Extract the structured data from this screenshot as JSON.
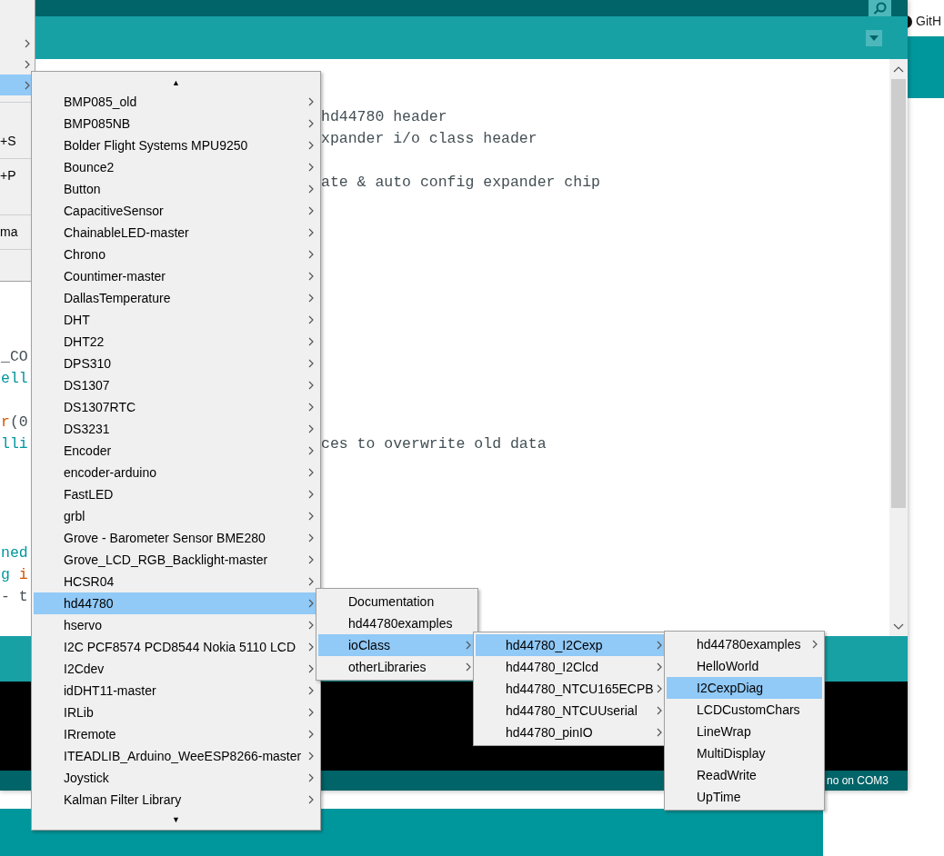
{
  "browser": {
    "link": "GitH"
  },
  "window": {
    "status": "no on COM3"
  },
  "file_menu": [
    {
      "kind": "submenu",
      "selected": false
    },
    {
      "kind": "submenu",
      "selected": false
    },
    {
      "kind": "submenu",
      "selected": true
    },
    {
      "kind": "separator"
    },
    {
      "kind": "blank"
    },
    {
      "kind": "shortcut",
      "text": "+S"
    },
    {
      "kind": "separator"
    },
    {
      "kind": "shortcut",
      "text": "+P"
    },
    {
      "kind": "blank"
    },
    {
      "kind": "separator"
    },
    {
      "kind": "shortcut",
      "text": "ma"
    },
    {
      "kind": "separator"
    }
  ],
  "editor": {
    "lines": [
      {
        "kind": "blank"
      },
      {
        "kind": "code",
        "right": "hd44780 header"
      },
      {
        "kind": "code",
        "right": "xpander i/o class header"
      },
      {
        "kind": "blank"
      },
      {
        "kind": "code",
        "right": "ate & auto config expander chip"
      },
      {
        "kind": "blank"
      },
      {
        "kind": "blank"
      },
      {
        "kind": "blank"
      },
      {
        "kind": "blank"
      },
      {
        "kind": "blank"
      },
      {
        "kind": "blank"
      },
      {
        "kind": "blank"
      },
      {
        "kind": "code",
        "left": [
          {
            "kind": "plain",
            "text": "_CO"
          }
        ]
      },
      {
        "kind": "code",
        "left": [
          {
            "kind": "literal",
            "text": "ell"
          }
        ]
      },
      {
        "kind": "blank"
      },
      {
        "kind": "code",
        "left": [
          {
            "kind": "keyword",
            "text": "r"
          },
          {
            "kind": "plain",
            "text": "(0"
          }
        ]
      },
      {
        "kind": "code",
        "left": [
          {
            "kind": "literal",
            "text": "lli"
          }
        ],
        "right": "ces to overwrite old data"
      },
      {
        "kind": "blank"
      },
      {
        "kind": "blank"
      },
      {
        "kind": "blank"
      },
      {
        "kind": "blank"
      },
      {
        "kind": "code",
        "left": [
          {
            "kind": "literal",
            "text": "ned"
          }
        ]
      },
      {
        "kind": "code",
        "left": [
          {
            "kind": "literal",
            "text": "g "
          },
          {
            "kind": "keyword",
            "text": "i"
          }
        ]
      },
      {
        "kind": "code",
        "left": [
          {
            "kind": "plain",
            "text": "- t"
          }
        ]
      }
    ]
  },
  "menus": [
    {
      "scroll_up": "▲",
      "scroll_down": "▼",
      "items": [
        {
          "label": "BMP085_old",
          "selected": false,
          "submenu": true
        },
        {
          "label": "BMP085NB",
          "selected": false,
          "submenu": true
        },
        {
          "label": "Bolder Flight Systems MPU9250",
          "selected": false,
          "submenu": true
        },
        {
          "label": "Bounce2",
          "selected": false,
          "submenu": true
        },
        {
          "label": "Button",
          "selected": false,
          "submenu": true
        },
        {
          "label": "CapacitiveSensor",
          "selected": false,
          "submenu": true
        },
        {
          "label": "ChainableLED-master",
          "selected": false,
          "submenu": true
        },
        {
          "label": "Chrono",
          "selected": false,
          "submenu": true
        },
        {
          "label": "Countimer-master",
          "selected": false,
          "submenu": true
        },
        {
          "label": "DallasTemperature",
          "selected": false,
          "submenu": true
        },
        {
          "label": "DHT",
          "selected": false,
          "submenu": true
        },
        {
          "label": "DHT22",
          "selected": false,
          "submenu": true
        },
        {
          "label": "DPS310",
          "selected": false,
          "submenu": true
        },
        {
          "label": "DS1307",
          "selected": false,
          "submenu": true
        },
        {
          "label": "DS1307RTC",
          "selected": false,
          "submenu": true
        },
        {
          "label": "DS3231",
          "selected": false,
          "submenu": true
        },
        {
          "label": "Encoder",
          "selected": false,
          "submenu": true
        },
        {
          "label": "encoder-arduino",
          "selected": false,
          "submenu": true
        },
        {
          "label": "FastLED",
          "selected": false,
          "submenu": true
        },
        {
          "label": "grbl",
          "selected": false,
          "submenu": true
        },
        {
          "label": "Grove - Barometer Sensor BME280",
          "selected": false,
          "submenu": true
        },
        {
          "label": "Grove_LCD_RGB_Backlight-master",
          "selected": false,
          "submenu": true
        },
        {
          "label": "HCSR04",
          "selected": false,
          "submenu": true
        },
        {
          "label": "hd44780",
          "selected": true,
          "submenu": true
        },
        {
          "label": "hservo",
          "selected": false,
          "submenu": true
        },
        {
          "label": "I2C PCF8574 PCD8544 Nokia 5110 LCD",
          "selected": false,
          "submenu": true
        },
        {
          "label": "I2Cdev",
          "selected": false,
          "submenu": true
        },
        {
          "label": "idDHT11-master",
          "selected": false,
          "submenu": true
        },
        {
          "label": "IRLib",
          "selected": false,
          "submenu": true
        },
        {
          "label": "IRremote",
          "selected": false,
          "submenu": true
        },
        {
          "label": "ITEADLIB_Arduino_WeeESP8266-master",
          "selected": false,
          "submenu": true
        },
        {
          "label": "Joystick",
          "selected": false,
          "submenu": true
        },
        {
          "label": "Kalman Filter Library",
          "selected": false,
          "submenu": true
        }
      ]
    },
    {
      "items": [
        {
          "label": "Documentation",
          "selected": false,
          "submenu": false
        },
        {
          "label": "hd44780examples",
          "selected": false,
          "submenu": false
        },
        {
          "label": "ioClass",
          "selected": true,
          "submenu": true
        },
        {
          "label": "otherLibraries",
          "selected": false,
          "submenu": true
        }
      ]
    },
    {
      "items": [
        {
          "label": "hd44780_I2Cexp",
          "selected": true,
          "submenu": true
        },
        {
          "label": "hd44780_I2Clcd",
          "selected": false,
          "submenu": true
        },
        {
          "label": "hd44780_NTCU165ECPB",
          "selected": false,
          "submenu": true
        },
        {
          "label": "hd44780_NTCUUserial",
          "selected": false,
          "submenu": true
        },
        {
          "label": "hd44780_pinIO",
          "selected": false,
          "submenu": true
        }
      ]
    },
    {
      "items": [
        {
          "label": "hd44780examples",
          "selected": false,
          "submenu": true
        },
        {
          "label": "HelloWorld",
          "selected": false,
          "submenu": false
        },
        {
          "label": "I2CexpDiag",
          "selected": true,
          "submenu": false
        },
        {
          "label": "LCDCustomChars",
          "selected": false,
          "submenu": false
        },
        {
          "label": "LineWrap",
          "selected": false,
          "submenu": false
        },
        {
          "label": "MultiDisplay",
          "selected": false,
          "submenu": false
        },
        {
          "label": "ReadWrite",
          "selected": false,
          "submenu": false
        },
        {
          "label": "UpTime",
          "selected": false,
          "submenu": false
        }
      ]
    }
  ]
}
